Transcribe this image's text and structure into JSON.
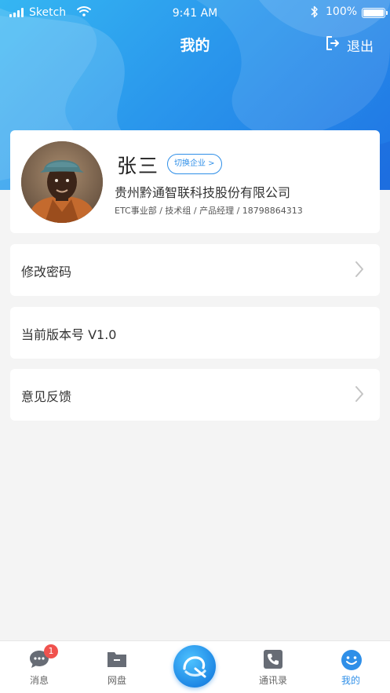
{
  "status_bar": {
    "carrier": "Sketch",
    "time": "9:41 AM",
    "battery": "100%"
  },
  "nav": {
    "title": "我的",
    "logout_label": "退出"
  },
  "profile": {
    "name": "张三",
    "switch_label": "切换企业 >",
    "company": "贵州黔通智联科技股份有限公司",
    "meta": "ETC事业部 / 技术组 / 产品经理 / 18798864313"
  },
  "menu": {
    "change_password": "修改密码",
    "version": "当前版本号 V1.0",
    "feedback": "意见反馈"
  },
  "tabs": [
    {
      "label": "消息",
      "icon": "chat-bubble-icon",
      "badge": "1"
    },
    {
      "label": "网盘",
      "icon": "folder-icon"
    },
    {
      "label": "",
      "icon": "center-logo-icon"
    },
    {
      "label": "通讯录",
      "icon": "phone-book-icon"
    },
    {
      "label": "我的",
      "icon": "smiley-icon",
      "active": true
    }
  ],
  "colors": {
    "accent": "#2f8fe8",
    "header_start": "#35b6f2",
    "header_end": "#1f74e4",
    "badge": "#f0524e",
    "page_bg": "#f4f4f4"
  }
}
